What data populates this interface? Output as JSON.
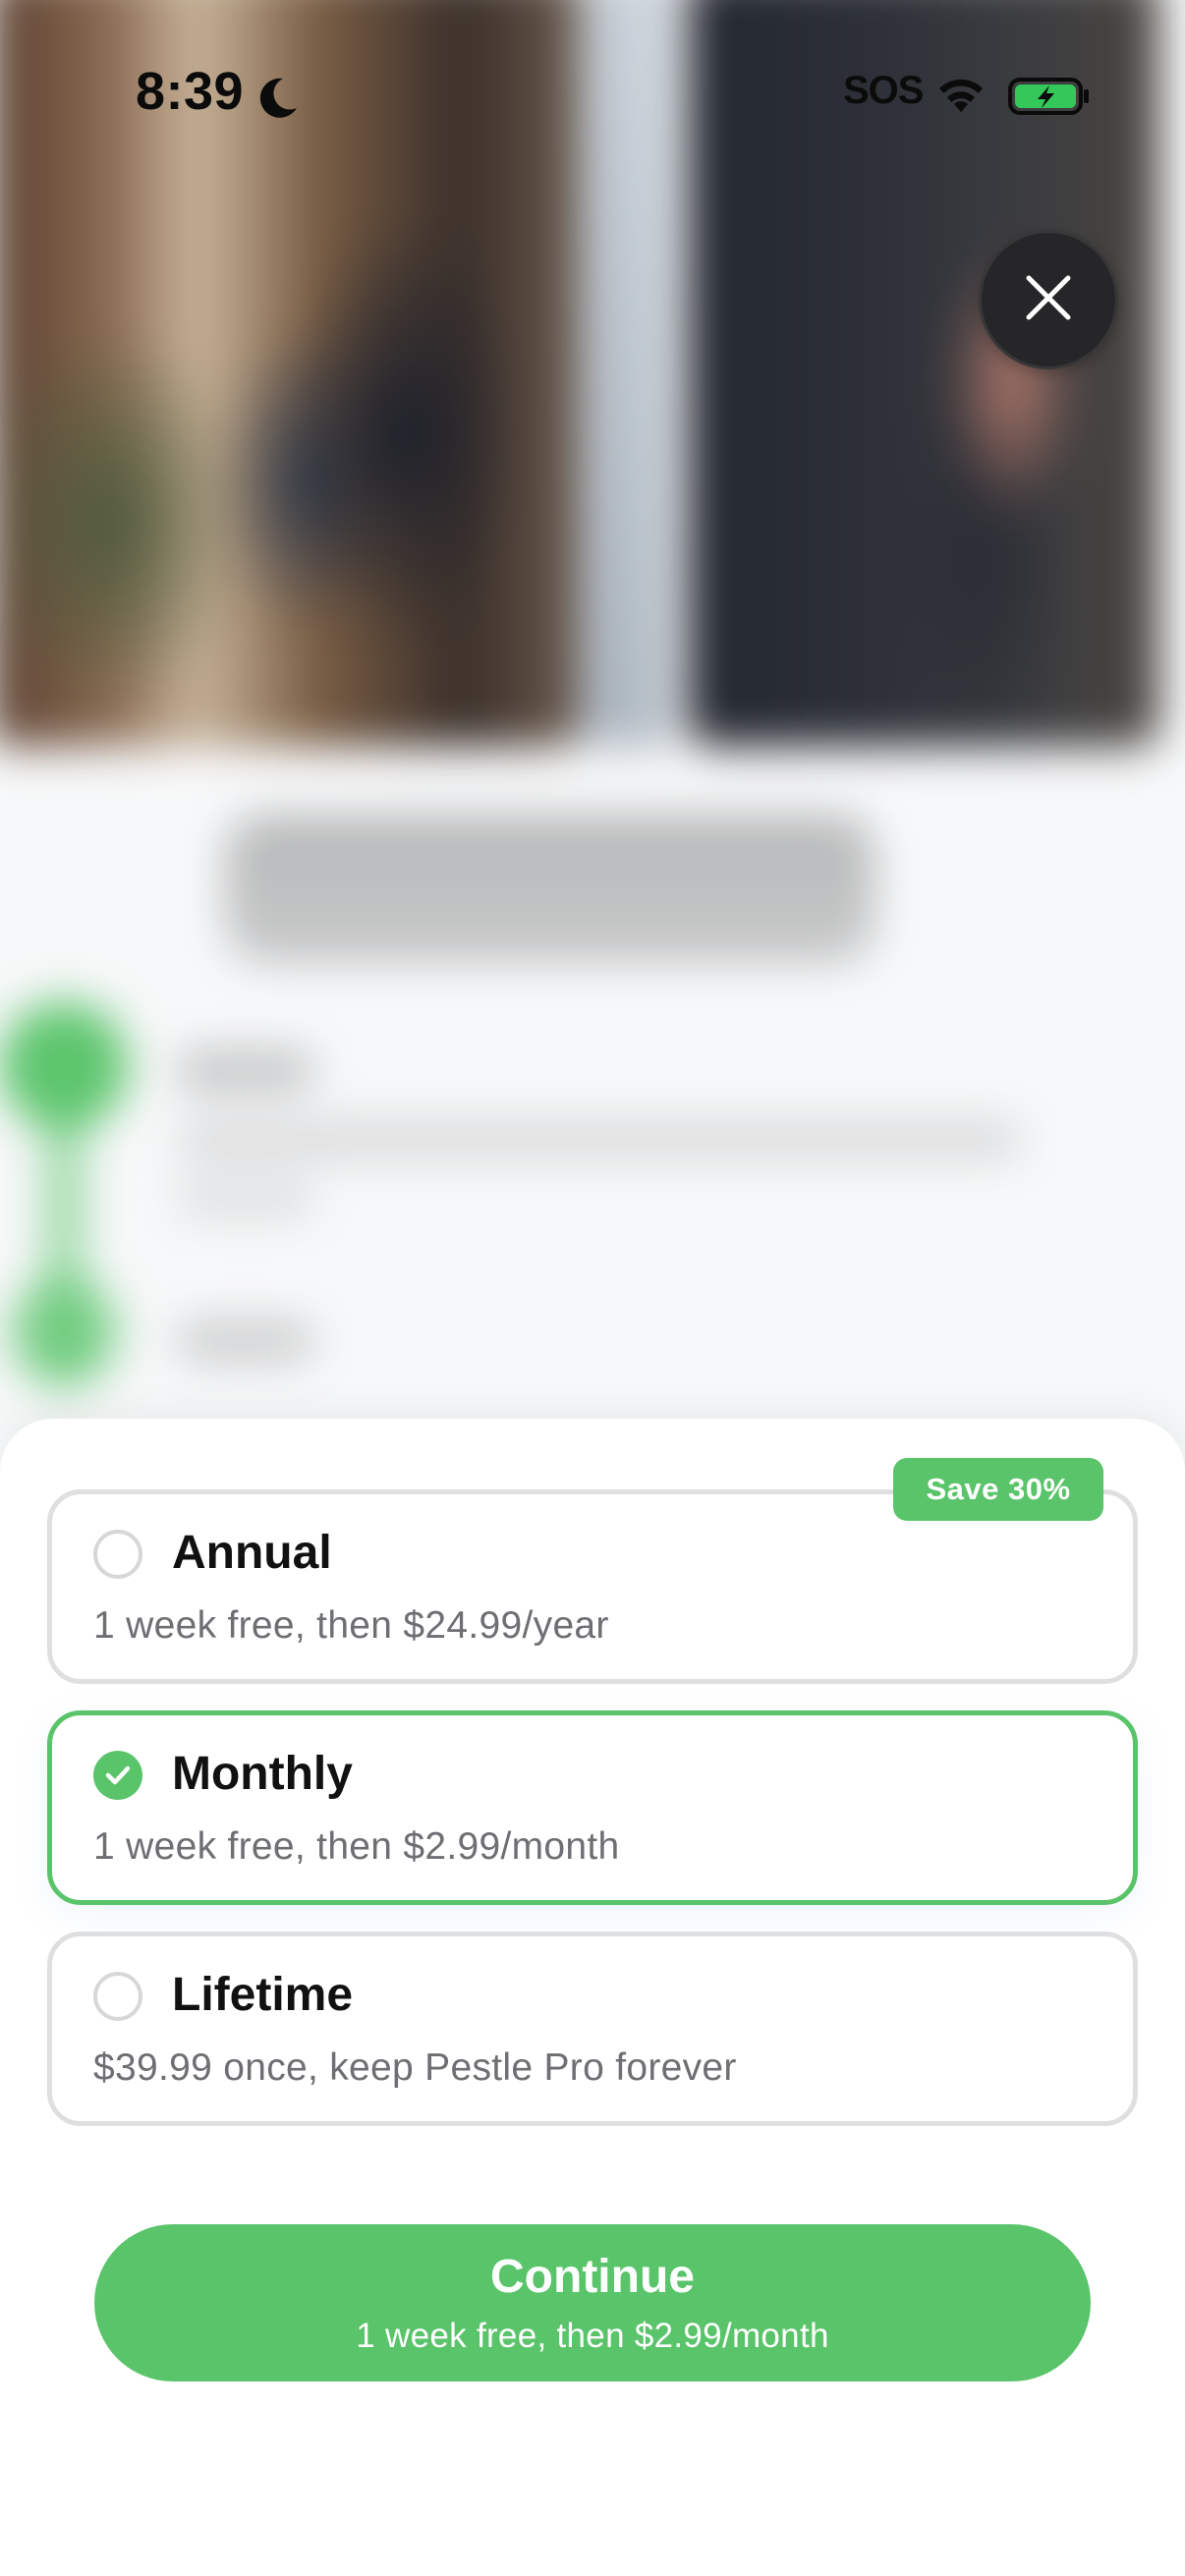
{
  "status_bar": {
    "time": "8:39",
    "carrier": "SOS",
    "icons": [
      "moon-icon",
      "wifi-icon",
      "battery-charging-icon"
    ]
  },
  "close_button": {
    "icon": "close-icon"
  },
  "plans": [
    {
      "title": "Annual",
      "description": "1 week free, then $24.99/year",
      "badge": "Save 30%",
      "selected": false
    },
    {
      "title": "Monthly",
      "description": "1 week free, then $2.99/month",
      "selected": true
    },
    {
      "title": "Lifetime",
      "description": "$39.99 once, keep Pestle Pro forever",
      "selected": false
    }
  ],
  "continue_button": {
    "label": "Continue",
    "sublabel": "1 week free, then $2.99/month"
  },
  "colors": {
    "accent": "#5ac46a",
    "card_border": "#dedfe1",
    "description_text": "#6e6e73",
    "title_text": "#111111",
    "close_button_bg": "#262628"
  }
}
